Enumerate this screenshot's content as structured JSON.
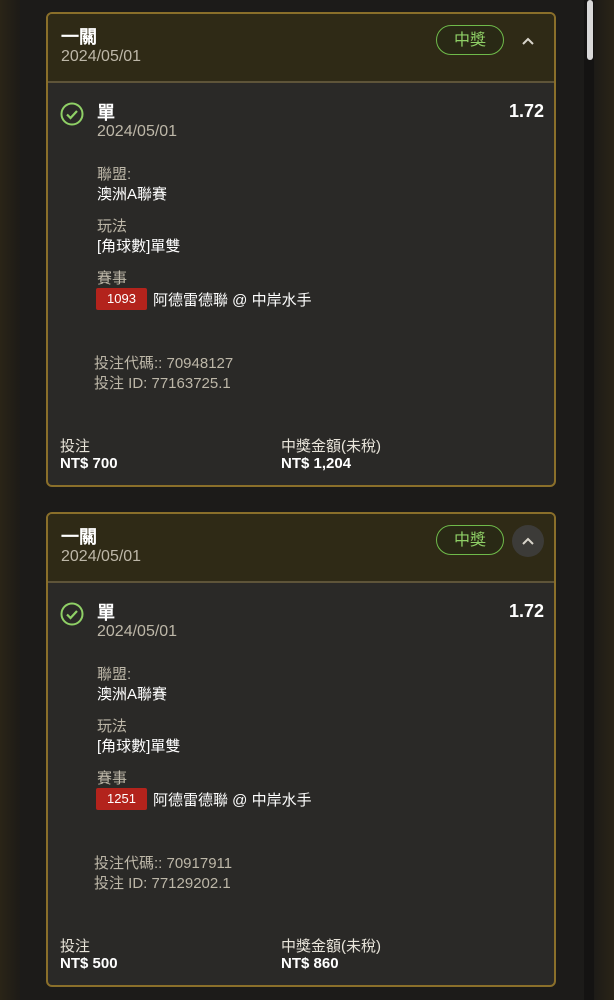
{
  "bets": [
    {
      "title": "一關",
      "date": "2024/05/01",
      "status": "中獎",
      "selection": {
        "type": "單",
        "date": "2024/05/01",
        "odds": "1.72",
        "league_label": "聯盟:",
        "league": "澳洲A聯賽",
        "market_label": "玩法",
        "market": "[角球數]單雙",
        "event_label": "賽事",
        "event_code": "1093",
        "event_name": "阿德雷德聯 @ 中岸水手"
      },
      "bet_code": "投注代碼:: 70948127",
      "bet_id": "投注 ID: 77163725.1",
      "stake_label": "投注",
      "stake": "NT$ 700",
      "payout_label": "中獎金額(未稅)",
      "payout": "NT$ 1,204"
    },
    {
      "title": "一關",
      "date": "2024/05/01",
      "status": "中獎",
      "selection": {
        "type": "單",
        "date": "2024/05/01",
        "odds": "1.72",
        "league_label": "聯盟:",
        "league": "澳洲A聯賽",
        "market_label": "玩法",
        "market": "[角球數]單雙",
        "event_label": "賽事",
        "event_code": "1251",
        "event_name": "阿德雷德聯 @ 中岸水手"
      },
      "bet_code": "投注代碼:: 70917911",
      "bet_id": "投注 ID: 77129202.1",
      "stake_label": "投注",
      "stake": "NT$ 500",
      "payout_label": "中獎金額(未稅)",
      "payout": "NT$ 860"
    }
  ],
  "colors": {
    "accent_border": "#8a6f2a",
    "win_green": "#8fd066",
    "event_red": "#b3231c"
  },
  "icons": {
    "collapse": "chevron-up-icon",
    "status": "check-circle-icon"
  }
}
